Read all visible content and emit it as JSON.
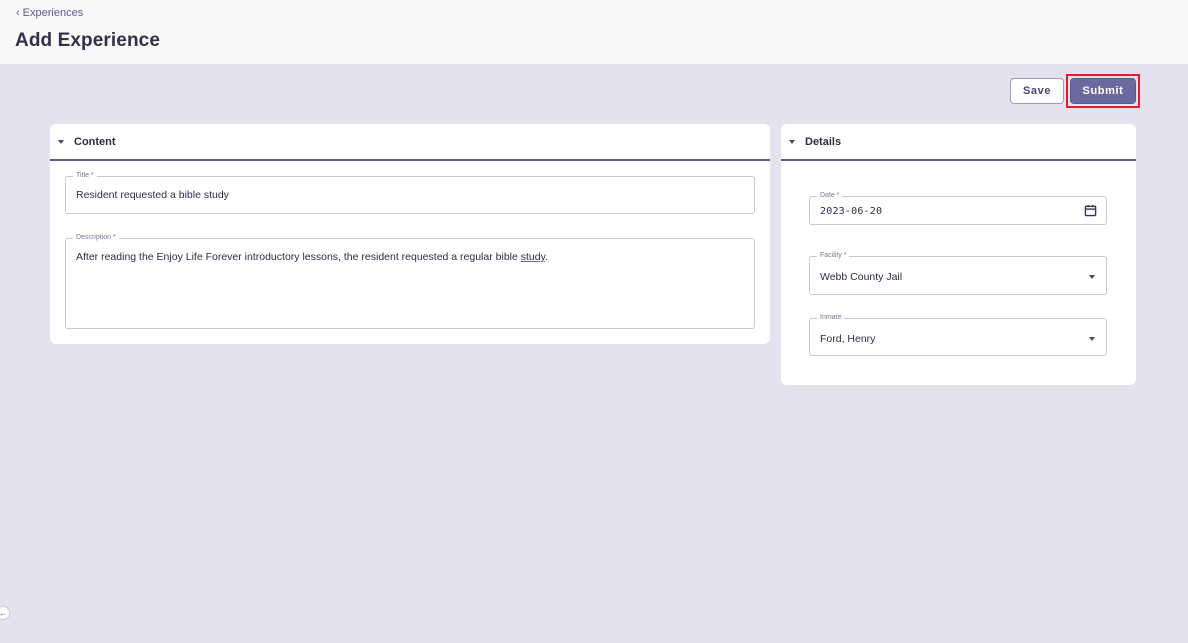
{
  "header": {
    "breadcrumb": "Experiences",
    "title": "Add Experience"
  },
  "actions": {
    "save_label": "Save",
    "submit_label": "Submit"
  },
  "content_section": {
    "heading": "Content",
    "title_field": {
      "label": "Title *",
      "value": "Resident requested a bible study"
    },
    "description_field": {
      "label": "Description *",
      "value_before": "After reading the Enjoy Life Forever introductory lessons, the resident requested a regular bible ",
      "value_underlined": "study",
      "value_after": "."
    }
  },
  "details_section": {
    "heading": "Details",
    "date_field": {
      "label": "Date *",
      "value": "2023-06-20",
      "icon": "calendar-icon"
    },
    "facility_field": {
      "label": "Facility *",
      "value": "Webb County Jail"
    },
    "inmate_field": {
      "label": "Inmate",
      "value": "Ford, Henry"
    }
  },
  "colors": {
    "accent": "#6b6a9e",
    "highlight": "#e11d2a",
    "background": "#e4e2ec"
  }
}
